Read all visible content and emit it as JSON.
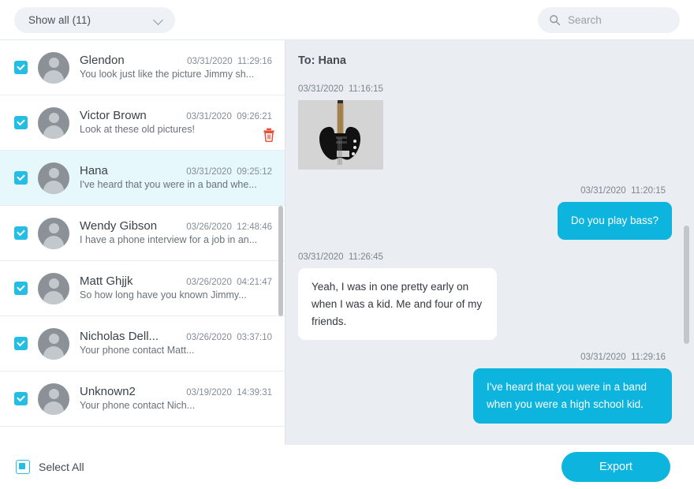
{
  "header": {
    "filter_label": "Show all (11)",
    "filter_icon": "chevron-down-icon",
    "search_icon": "search-icon",
    "search_placeholder": "Search",
    "search_value": ""
  },
  "colors": {
    "accent": "#0cb4de",
    "checkbox": "#24bde4",
    "conversation_bg": "#eaeef3",
    "selected_row": "#e7f8fd",
    "trash": "#e8503a"
  },
  "list": {
    "scrollbar": "list-scrollbar",
    "items": [
      {
        "name": "Glendon",
        "date": "03/31/2020",
        "time": "11:29:16",
        "preview": "You look just like the picture Jimmy sh...",
        "checked": true,
        "selected": false,
        "has_delete": false
      },
      {
        "name": "Victor Brown",
        "date": "03/31/2020",
        "time": "09:26:21",
        "preview": "Look at these old pictures!",
        "checked": true,
        "selected": false,
        "has_delete": true
      },
      {
        "name": "Hana",
        "date": "03/31/2020",
        "time": "09:25:12",
        "preview": "I've heard that you were in a band whe...",
        "checked": true,
        "selected": true,
        "has_delete": false
      },
      {
        "name": "Wendy Gibson",
        "date": "03/26/2020",
        "time": "12:48:46",
        "preview": "I have a phone interview for a job in an...",
        "checked": true,
        "selected": false,
        "has_delete": false
      },
      {
        "name": "Matt Ghjjk",
        "date": "03/26/2020",
        "time": "04:21:47",
        "preview": "So how long have you known Jimmy...",
        "checked": true,
        "selected": false,
        "has_delete": false
      },
      {
        "name": "Nicholas Dell...",
        "date": "03/26/2020",
        "time": "03:37:10",
        "preview": "Your phone contact Matt...",
        "checked": true,
        "selected": false,
        "has_delete": false
      },
      {
        "name": "Unknown2",
        "date": "03/19/2020",
        "time": "14:39:31",
        "preview": "Your phone contact Nich...",
        "checked": true,
        "selected": false,
        "has_delete": false
      }
    ]
  },
  "conversation": {
    "title": "To: Hana",
    "messages": [
      {
        "direction": "incoming",
        "date": "03/31/2020",
        "time": "11:16:15",
        "type": "image",
        "text": "",
        "image_name": "bass-guitar-attachment"
      },
      {
        "direction": "outgoing",
        "date": "03/31/2020",
        "time": "11:20:15",
        "type": "text",
        "text": "Do you play bass?"
      },
      {
        "direction": "incoming",
        "date": "03/31/2020",
        "time": "11:26:45",
        "type": "text",
        "text": "Yeah, I was in one pretty early on when I was a kid. Me and four of my friends."
      },
      {
        "direction": "outgoing",
        "date": "03/31/2020",
        "time": "11:29:16",
        "type": "text",
        "text": "I've heard that you were in a band when you were a high school kid."
      }
    ]
  },
  "footer": {
    "select_all_label": "Select All",
    "select_all_state": "indeterminate",
    "export_label": "Export"
  }
}
